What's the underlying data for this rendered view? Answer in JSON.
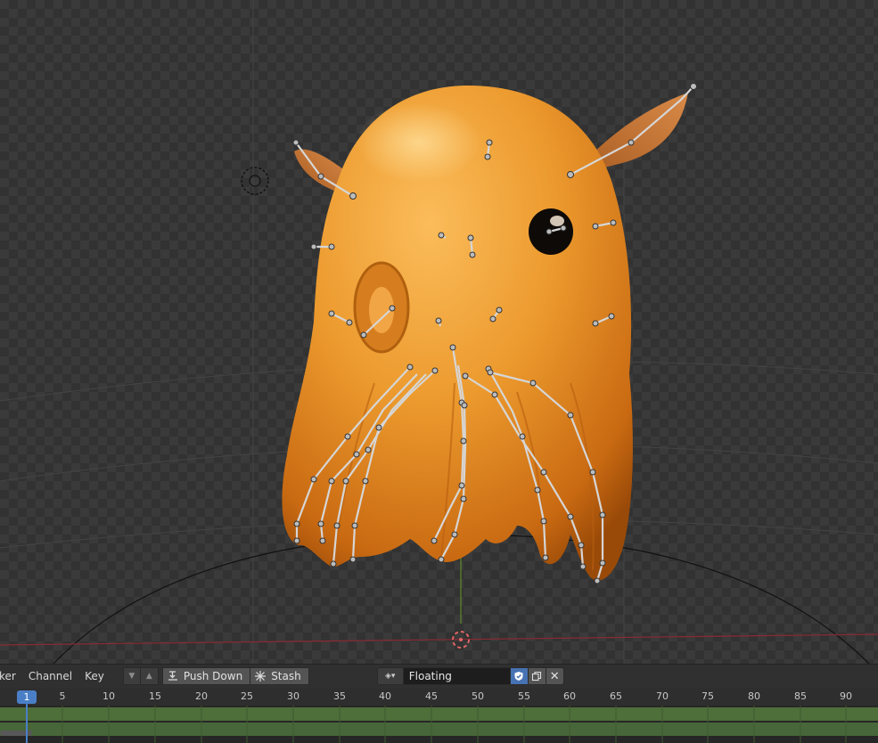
{
  "header": {
    "menus": [
      "ker",
      "Channel",
      "Key"
    ],
    "push_down_label": "Push Down",
    "stash_label": "Stash",
    "action_name": "Floating"
  },
  "timeline": {
    "current_frame": "1",
    "tick_labels": [
      "5",
      "10",
      "15",
      "20",
      "25",
      "30",
      "35",
      "40",
      "45",
      "50",
      "55",
      "60",
      "65",
      "70",
      "75",
      "80",
      "85",
      "90"
    ]
  },
  "colors": {
    "accent": "#4a7fc7",
    "channel_green": "#4e6e3a",
    "model_orange": "#e8952a"
  }
}
